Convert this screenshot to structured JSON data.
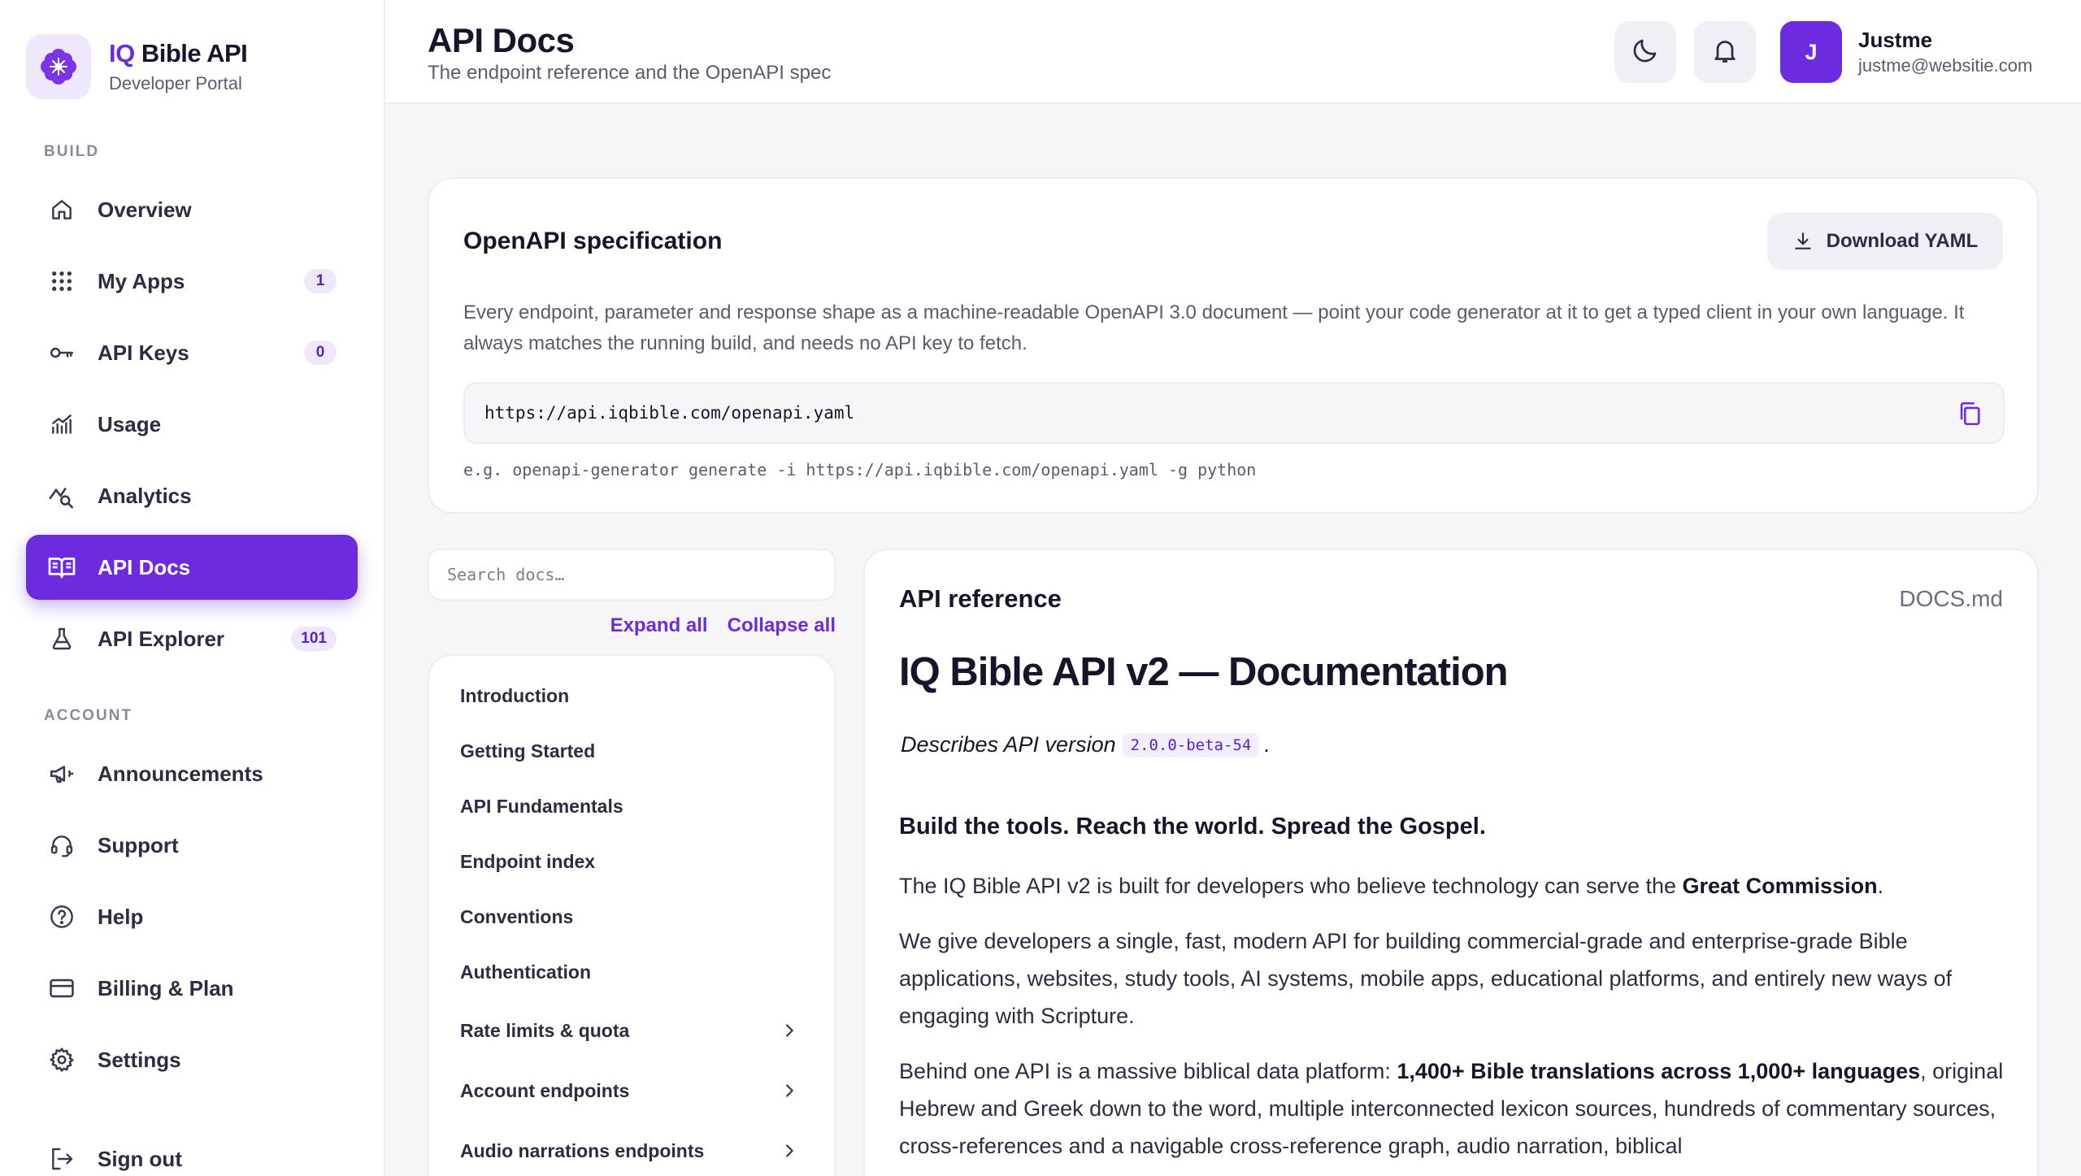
{
  "brand": {
    "name_accent": "IQ",
    "name_rest": " Bible API",
    "subtitle": "Developer Portal"
  },
  "sidebar": {
    "build_label": "BUILD",
    "account_label": "ACCOUNT",
    "items": [
      {
        "label": "Overview",
        "icon": "home-icon"
      },
      {
        "label": "My Apps",
        "icon": "grid-icon",
        "badge": "1"
      },
      {
        "label": "API Keys",
        "icon": "key-icon",
        "badge": "0"
      },
      {
        "label": "Usage",
        "icon": "chart-icon"
      },
      {
        "label": "Analytics",
        "icon": "analytics-icon"
      },
      {
        "label": "API Docs",
        "icon": "book-icon",
        "active": true
      },
      {
        "label": "API Explorer",
        "icon": "flask-icon",
        "badge": "101"
      },
      {
        "label": "Announcements",
        "icon": "megaphone-icon"
      },
      {
        "label": "Support",
        "icon": "headset-icon"
      },
      {
        "label": "Help",
        "icon": "help-icon"
      },
      {
        "label": "Billing & Plan",
        "icon": "card-icon"
      },
      {
        "label": "Settings",
        "icon": "gear-icon"
      },
      {
        "label": "Sign out",
        "icon": "logout-icon"
      }
    ]
  },
  "header": {
    "title": "API Docs",
    "subtitle": "The endpoint reference and the OpenAPI spec",
    "theme_icon": "moon-icon",
    "notif_icon": "bell-icon",
    "user": {
      "initial": "J",
      "name": "Justme",
      "email": "justme@websitie.com"
    }
  },
  "spec": {
    "title": "OpenAPI specification",
    "download_label": "Download YAML",
    "description": "Every endpoint, parameter and response shape as a machine-readable OpenAPI 3.0 document — point your code generator at it to get a typed client in your own language. It always matches the running build, and needs no API key to fetch.",
    "url": "https://api.iqbible.com/openapi.yaml",
    "example": "e.g. openapi-generator generate -i https://api.iqbible.com/openapi.yaml -g python"
  },
  "docs_nav": {
    "search_placeholder": "Search docs…",
    "expand_all": "Expand all",
    "collapse_all": "Collapse all",
    "items": [
      {
        "label": "Introduction"
      },
      {
        "label": "Getting Started"
      },
      {
        "label": "API Fundamentals"
      },
      {
        "label": "Endpoint index"
      },
      {
        "label": "Conventions"
      },
      {
        "label": "Authentication"
      },
      {
        "label": "Rate limits & quota",
        "expandable": true
      },
      {
        "label": "Account endpoints",
        "expandable": true
      },
      {
        "label": "Audio narrations endpoints",
        "expandable": true
      }
    ]
  },
  "reference": {
    "label": "API reference",
    "file": "DOCS.md",
    "h1": "IQ Bible API v2 — Documentation",
    "version_prefix": "Describes API version",
    "version": "2.0.0-beta-54",
    "version_suffix": ".",
    "tagline": "Build the tools. Reach the world. Spread the Gospel.",
    "p1_pre": "The IQ Bible API v2 is built for developers who believe technology can serve the ",
    "p1_bold": "Great Commission",
    "p1_post": ".",
    "p2": "We give developers a single, fast, modern API for building commercial-grade and enterprise-grade Bible applications, websites, study tools, AI systems, mobile apps, educational platforms, and entirely new ways of engaging with Scripture.",
    "p3_pre": "Behind one API is a massive biblical data platform: ",
    "p3_bold": "1,400+ Bible translations across 1,000+ languages",
    "p3_post": ", original Hebrew and Greek down to the word, multiple interconnected lexicon sources, hundreds of commentary sources, cross-references and a navigable cross-reference graph, audio narration, biblical"
  },
  "colors": {
    "accent": "#6d2be0",
    "accent_soft": "#efe7fb",
    "background": "#f6f6f9"
  }
}
